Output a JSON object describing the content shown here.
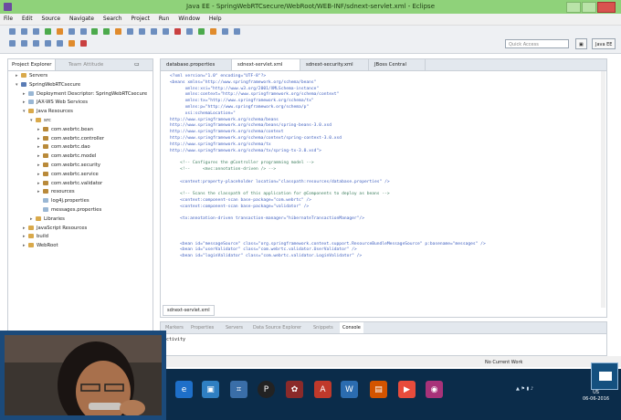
{
  "window": {
    "title": "Java EE - SpringWebRTCsecure/WebRoot/WEB-INF/sdnext-servlet.xml - Eclipse"
  },
  "menu": [
    "File",
    "Edit",
    "Source",
    "Navigate",
    "Search",
    "Project",
    "Run",
    "Window",
    "Help"
  ],
  "toolbar": {
    "quick_access_placeholder": "Quick Access",
    "perspective_label": "Java EE"
  },
  "project_explorer": {
    "tabs": [
      "Project Explorer",
      "Team Attitude"
    ],
    "items": [
      {
        "label": "Servers"
      },
      {
        "label": "SpringWebRTCsecure"
      },
      {
        "label": "Deployment Descriptor: SpringWebRTCsecure"
      },
      {
        "label": "JAX-WS Web Services"
      },
      {
        "label": "Java Resources"
      },
      {
        "label": "src"
      },
      {
        "label": "com.webrtc.bean"
      },
      {
        "label": "com.webrtc.controller"
      },
      {
        "label": "com.webrtc.dao"
      },
      {
        "label": "com.webrtc.model"
      },
      {
        "label": "com.webrtc.security"
      },
      {
        "label": "com.webrtc.service"
      },
      {
        "label": "com.webrtc.validator"
      },
      {
        "label": "resources"
      },
      {
        "label": "log4j.properties"
      },
      {
        "label": "messages.properties"
      },
      {
        "label": "Libraries"
      },
      {
        "label": "JavaScript Resources"
      },
      {
        "label": "build"
      },
      {
        "label": "WebRoot"
      }
    ]
  },
  "editor": {
    "tabs": [
      "database.properties",
      "sdnext-servlet.xml",
      "sdnext-security.xml",
      "JBoss Central"
    ],
    "lines": [
      "<?xml version=\"1.0\" encoding=\"UTF-8\"?>",
      "<beans xmlns=\"http://www.springframework.org/schema/beans\"",
      "      xmlns:xsi=\"http://www.w3.org/2001/XMLSchema-instance\"",
      "      xmlns:context=\"http://www.springframework.org/schema/context\"",
      "      xmlns:tx=\"http://www.springframework.org/schema/tx\"",
      "      xmlns:p=\"http://www.springframework.org/schema/p\"",
      "      xsi:schemaLocation=\"",
      "http://www.springframework.org/schema/beans",
      "http://www.springframework.org/schema/beans/spring-beans-3.0.xsd",
      "http://www.springframework.org/schema/context",
      "http://www.springframework.org/schema/context/spring-context-3.0.xsd",
      "http://www.springframework.org/schema/tx",
      "http://www.springframework.org/schema/tx/spring-tx-3.0.xsd\">",
      "",
      "    <!-- Configures the @Controller programming model -->",
      "    <!--     <mvc:annotation-driven /> -->",
      "",
      "    <context:property-placeholder location=\"classpath:resources/database.properties\" />",
      "",
      "    <!-- Scans the classpath of this application for @Components to deploy as beans -->",
      "    <context:component-scan base-package=\"com.webrtc\" />",
      "    <context:component-scan base-package=\"validator\" />",
      "",
      "    <tx:annotation-driven transaction-manager=\"hibernateTransactionManager\"/>",
      "",
      "",
      "",
      "    <bean id=\"messageSource\" class=\"org.springframework.context.support.ResourceBundleMessageSource\" p:basename=\"messages\" />",
      "    <bean id=\"userValidator\" class=\"com.webrtc.validator.UserValidator\" />",
      "    <bean id=\"loginValidator\" class=\"com.webrtc.validator.LoginValidator\" />"
    ],
    "bottom_tab": "sdnext-servlet.xml"
  },
  "bottom_panel": {
    "tabs": [
      "Markers",
      "Properties",
      "Servers",
      "Data Source Explorer",
      "Snippets",
      "Console"
    ],
    "console_text": "ctivity"
  },
  "status": {
    "current_work": "No Current Work"
  },
  "tray": {
    "language": "ENG\nUS",
    "time": "06-06-2016"
  }
}
